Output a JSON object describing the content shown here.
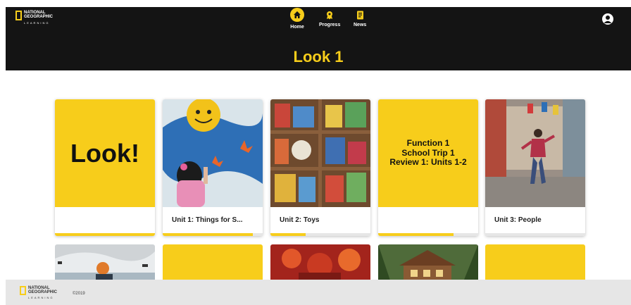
{
  "brand": {
    "line1": "NATIONAL",
    "line2": "GEOGRAPHIC",
    "line3": "LEARNING"
  },
  "nav": {
    "home": "Home",
    "progress": "Progress",
    "news": "News"
  },
  "page_title": "Look 1",
  "cards": [
    {
      "cover_text": "Look!",
      "label": "",
      "progress": 1.0
    },
    {
      "label": "Unit 1: Things for S...",
      "progress": 0.9
    },
    {
      "label": "Unit 2: Toys",
      "progress": 0.35
    },
    {
      "cover_lines": [
        "Function 1",
        "School Trip 1",
        "Review 1: Units 1-2"
      ],
      "label": "",
      "progress": 0.75
    },
    {
      "label": "Unit 3: People",
      "progress": 0.0
    }
  ],
  "footer": {
    "copyright": "©2019"
  },
  "colors": {
    "brand_yellow": "#f7cd1b",
    "header_bg": "#141414",
    "footer_bg": "#e6e6e6"
  },
  "icons": [
    "home-icon",
    "progress-icon",
    "news-icon",
    "user-icon"
  ]
}
